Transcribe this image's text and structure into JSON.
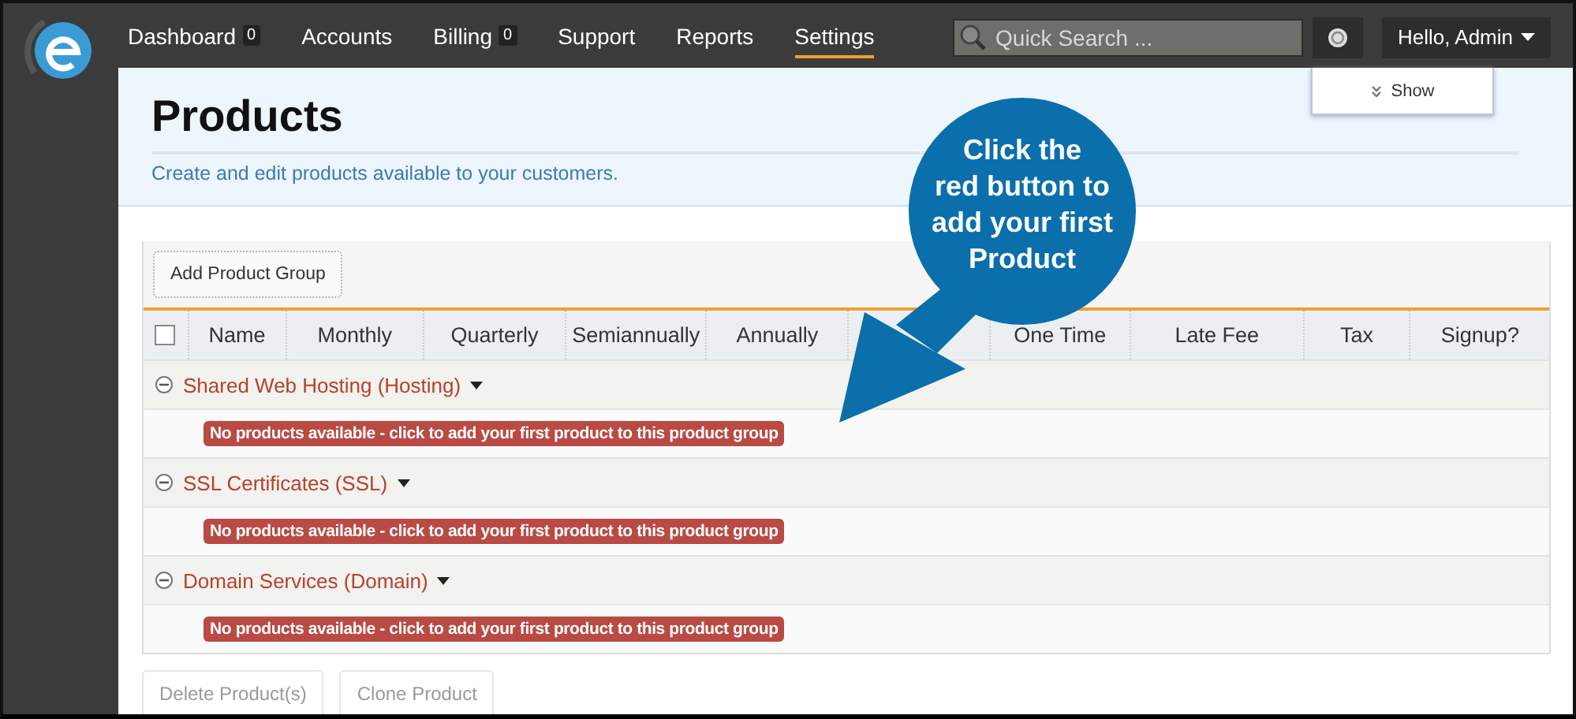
{
  "nav": {
    "items": [
      {
        "label": "Dashboard",
        "badge": "0",
        "selected": false
      },
      {
        "label": "Accounts",
        "selected": false
      },
      {
        "label": "Billing",
        "badge": "0",
        "selected": false
      },
      {
        "label": "Support",
        "selected": false
      },
      {
        "label": "Reports",
        "selected": false
      },
      {
        "label": "Settings",
        "selected": true
      }
    ],
    "search": {
      "placeholder": "Quick Search ..."
    },
    "user_menu": {
      "label": "Hello, Admin"
    }
  },
  "show_toggle": {
    "label": "Show"
  },
  "page": {
    "title": "Products",
    "subtitle": "Create and edit products available to your customers."
  },
  "toolbar": {
    "buttons": [
      "Add Product Group"
    ]
  },
  "table": {
    "select_all_checked": false,
    "columns": [
      {
        "kind": "text",
        "label": "Name"
      },
      {
        "kind": "text",
        "label": "Monthly"
      },
      {
        "kind": "text",
        "label": "Quarterly"
      },
      {
        "kind": "text",
        "label": "Semiannually"
      },
      {
        "kind": "text",
        "label": "Annually"
      },
      {
        "kind": "covered"
      },
      {
        "kind": "text",
        "label": "One Time"
      },
      {
        "kind": "text",
        "label": "Late Fee"
      },
      {
        "kind": "text",
        "label": "Tax"
      },
      {
        "kind": "text",
        "label": "Signup?"
      }
    ],
    "groups": [
      {
        "name": "Shared Web Hosting (Hosting)",
        "expanded": true,
        "empty_message": "No products available - click to add your first product to this product group"
      },
      {
        "name": "SSL Certificates (SSL)",
        "expanded": true,
        "empty_message": "No products available - click to add your first product to this product group"
      },
      {
        "name": "Domain Services (Domain)",
        "expanded": true,
        "empty_message": "No products available - click to add your first product to this product group"
      }
    ]
  },
  "footer_buttons": [
    {
      "label": "Delete Product(s)",
      "disabled": true
    },
    {
      "label": "Clone Product",
      "disabled": true
    }
  ],
  "callout": {
    "text": "Click the\nred button to\nadd your first\nProduct"
  }
}
